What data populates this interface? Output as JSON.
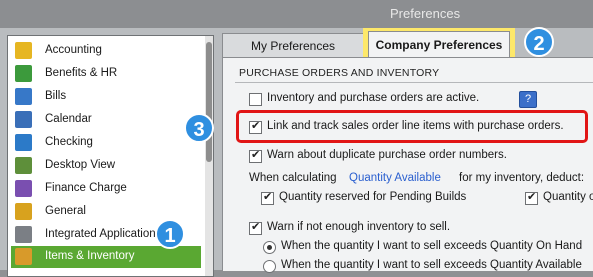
{
  "window": {
    "title": "Preferences"
  },
  "tabs": [
    {
      "label": "My Preferences",
      "active": false
    },
    {
      "label": "Company Preferences",
      "active": true
    }
  ],
  "sidebar": {
    "items": [
      {
        "label": "Accounting",
        "icon": "accounting-icon",
        "color": "#e6b622"
      },
      {
        "label": "Benefits & HR",
        "icon": "people-icon",
        "color": "#3c9a3c"
      },
      {
        "label": "Bills",
        "icon": "bill-icon",
        "color": "#3778c8"
      },
      {
        "label": "Calendar",
        "icon": "calendar-icon",
        "color": "#3a6fb8"
      },
      {
        "label": "Checking",
        "icon": "checkbook-icon",
        "color": "#2c7ac8"
      },
      {
        "label": "Desktop View",
        "icon": "desktop-icon",
        "color": "#5e8f3a"
      },
      {
        "label": "Finance Charge",
        "icon": "percent-icon",
        "color": "#7a4fb0"
      },
      {
        "label": "General",
        "icon": "general-icon",
        "color": "#d8a21e"
      },
      {
        "label": "Integrated Applications",
        "icon": "apps-icon",
        "color": "#7b7f85"
      },
      {
        "label": "Items & Inventory",
        "icon": "inventory-icon",
        "color": "#d89a2a",
        "selected": true
      }
    ]
  },
  "section": {
    "title": "PURCHASE ORDERS AND INVENTORY"
  },
  "options": {
    "active": "Inventory and purchase orders are active.",
    "link_track": "Link and track sales order line items with purchase orders.",
    "warn_duplicate": "Warn about duplicate purchase order numbers.",
    "when_calculating": "When calculating",
    "quantity_available": "Quantity Available",
    "for_my_inventory": "for my inventory, deduct:",
    "qty_reserved": "Quantity reserved for Pending Builds",
    "qty_on": "Quantity o",
    "warn_not_enough": "Warn if not enough inventory to sell.",
    "radio_on_hand": "When the quantity I want to sell exceeds Quantity On Hand",
    "radio_available": "When the quantity I want to sell exceeds Quantity Available"
  },
  "help_label": "?",
  "badges": {
    "one": "1",
    "two": "2",
    "three": "3"
  },
  "colors": {
    "highlight": "#fde86a",
    "callout": "#e11515",
    "badge": "#2f8fe0",
    "selected": "#5aa832"
  }
}
